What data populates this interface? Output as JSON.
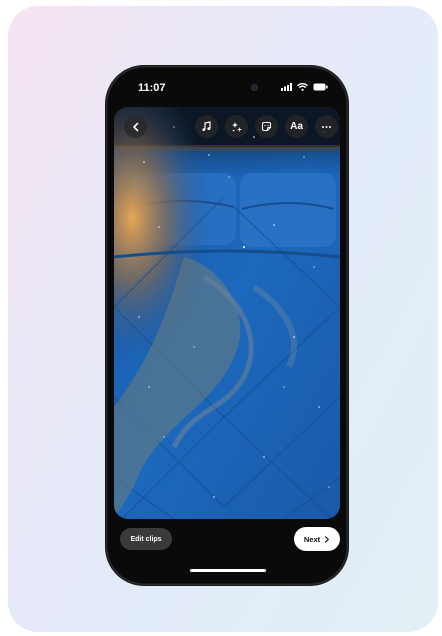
{
  "status_bar": {
    "time": "11:07",
    "icons": [
      "signal-icon",
      "wifi-icon",
      "battery-icon"
    ]
  },
  "toolbar": {
    "back_icon": "chevron-left-icon",
    "tools": [
      "music-note-icon",
      "sparkles-effects-icon",
      "sticker-icon",
      "text-tool",
      "more-icon"
    ],
    "text_tool_label": "Aa"
  },
  "canvas": {
    "description_icon": "photo-preview"
  },
  "bottom_bar": {
    "edit_clips_label": "Edit clips",
    "next_label": "Next"
  },
  "colors": {
    "accent_blue": "#1e63b0",
    "background_gradient_start": "#f6e4f1",
    "background_gradient_end": "#e2f0f5"
  }
}
